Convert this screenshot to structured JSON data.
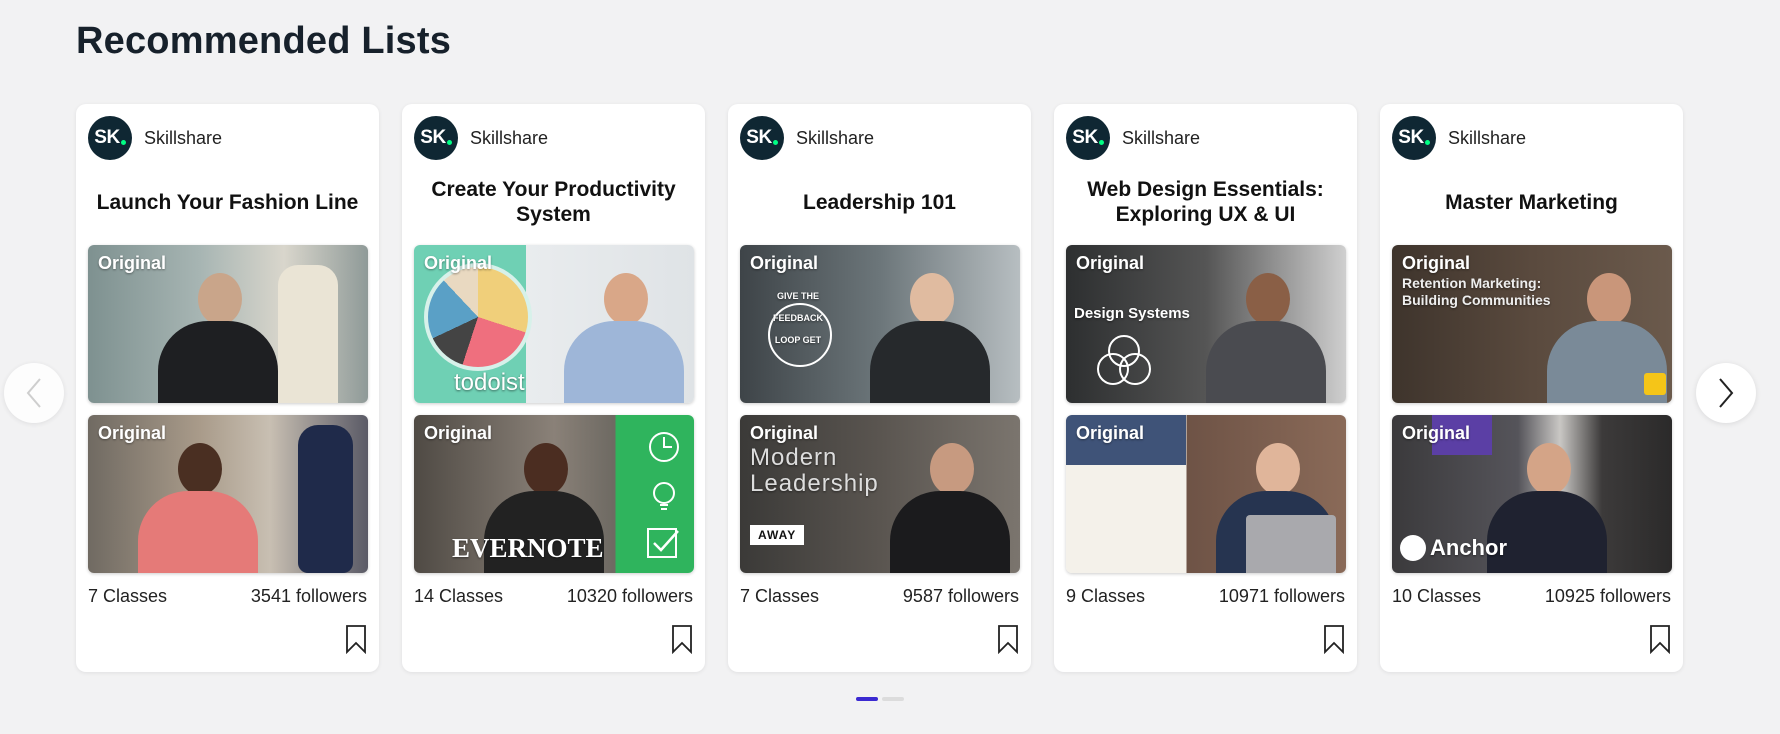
{
  "section": {
    "title": "Recommended Lists"
  },
  "carousel": {
    "prev_label": "Previous",
    "next_label": "Next",
    "pages": 2,
    "active_page": 1
  },
  "cards": [
    {
      "provider": "Skillshare",
      "avatar_text": "SK",
      "title": "Launch Your Fashion Line",
      "classes": "7 Classes",
      "followers": "3541 followers",
      "thumbnails": [
        {
          "badge": "Original",
          "overlay": ""
        },
        {
          "badge": "Original",
          "overlay": ""
        }
      ]
    },
    {
      "provider": "Skillshare",
      "avatar_text": "SK",
      "title": "Create Your Productivity System",
      "classes": "14 Classes",
      "followers": "10320 followers",
      "thumbnails": [
        {
          "badge": "Original",
          "overlay": "todoist"
        },
        {
          "badge": "Original",
          "overlay": "EVERNOTE"
        }
      ]
    },
    {
      "provider": "Skillshare",
      "avatar_text": "SK",
      "title": "Leadership 101",
      "classes": "7 Classes",
      "followers": "9587 followers",
      "thumbnails": [
        {
          "badge": "Original",
          "overlay": "GIVE THE FEEDBACK LOOP GET"
        },
        {
          "badge": "Original",
          "overlay": "Modern Leadership",
          "tag": "AWAY"
        }
      ]
    },
    {
      "provider": "Skillshare",
      "avatar_text": "SK",
      "title": "Web Design Essentials: Exploring UX & UI",
      "classes": "9 Classes",
      "followers": "10971 followers",
      "thumbnails": [
        {
          "badge": "Original",
          "overlay": "Design Systems"
        },
        {
          "badge": "Original",
          "overlay": ""
        }
      ]
    },
    {
      "provider": "Skillshare",
      "avatar_text": "SK",
      "title": "Master Marketing",
      "classes": "10 Classes",
      "followers": "10925 followers",
      "thumbnails": [
        {
          "badge": "Original",
          "overlay": "Retention Marketing: Building Communities"
        },
        {
          "badge": "Original",
          "overlay": "Anchor"
        }
      ]
    }
  ],
  "colors": {
    "background": "#f2f2f3",
    "avatar": "#0f2733",
    "avatar_dot": "#00ff84",
    "pager_active": "#3b2ad1",
    "pager_inactive": "#dcdcdc"
  }
}
